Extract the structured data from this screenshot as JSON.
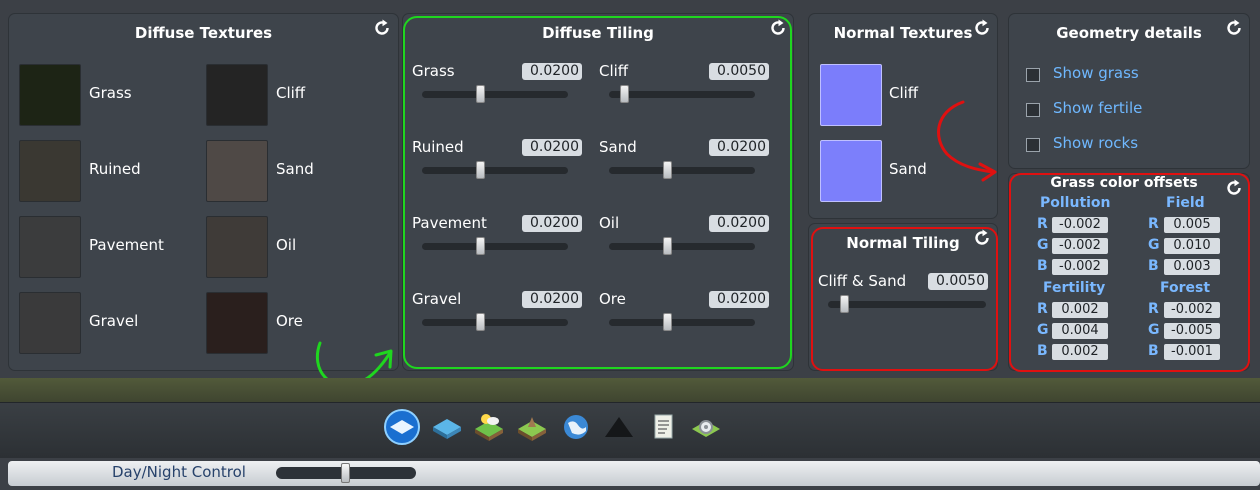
{
  "diffuse_textures": {
    "title": "Diffuse Textures",
    "items": [
      {
        "label": "Grass",
        "color": "#1d2415"
      },
      {
        "label": "Cliff",
        "color": "#242424"
      },
      {
        "label": "Ruined",
        "color": "#3a3832"
      },
      {
        "label": "Sand",
        "color": "#4f4946"
      },
      {
        "label": "Pavement",
        "color": "#3b3c3d"
      },
      {
        "label": "Oil",
        "color": "#3f3b38"
      },
      {
        "label": "Gravel",
        "color": "#3a3a3b"
      },
      {
        "label": "Ore",
        "color": "#2a1f1d"
      }
    ]
  },
  "diffuse_tiling": {
    "title": "Diffuse Tiling",
    "items": [
      {
        "label": "Grass",
        "value": "0.0200"
      },
      {
        "label": "Cliff",
        "value": "0.0050"
      },
      {
        "label": "Ruined",
        "value": "0.0200"
      },
      {
        "label": "Sand",
        "value": "0.0200"
      },
      {
        "label": "Pavement",
        "value": "0.0200"
      },
      {
        "label": "Oil",
        "value": "0.0200"
      },
      {
        "label": "Gravel",
        "value": "0.0200"
      },
      {
        "label": "Ore",
        "value": "0.0200"
      }
    ]
  },
  "normal_textures": {
    "title": "Normal Textures",
    "items": [
      {
        "label": "Cliff",
        "color": "#7b7dfb"
      },
      {
        "label": "Sand",
        "color": "#7c7ffb"
      }
    ]
  },
  "normal_tiling": {
    "title": "Normal Tiling",
    "items": [
      {
        "label": "Cliff & Sand",
        "value": "0.0050"
      }
    ]
  },
  "geometry_details": {
    "title": "Geometry details",
    "options": [
      {
        "label": "Show grass",
        "checked": false
      },
      {
        "label": "Show fertile",
        "checked": false
      },
      {
        "label": "Show rocks",
        "checked": false
      }
    ]
  },
  "grass_color_offsets": {
    "title": "Grass color offsets",
    "groups": [
      {
        "name": "Pollution",
        "channels": [
          {
            "ch": "R",
            "value": "-0.002"
          },
          {
            "ch": "G",
            "value": "-0.002"
          },
          {
            "ch": "B",
            "value": "-0.002"
          }
        ]
      },
      {
        "name": "Field",
        "channels": [
          {
            "ch": "R",
            "value": "0.005"
          },
          {
            "ch": "G",
            "value": "0.010"
          },
          {
            "ch": "B",
            "value": "0.003"
          }
        ]
      },
      {
        "name": "Fertility",
        "channels": [
          {
            "ch": "R",
            "value": "0.002"
          },
          {
            "ch": "G",
            "value": "0.004"
          },
          {
            "ch": "B",
            "value": "0.002"
          }
        ]
      },
      {
        "name": "Forest",
        "channels": [
          {
            "ch": "R",
            "value": "-0.002"
          },
          {
            "ch": "G",
            "value": "-0.005"
          },
          {
            "ch": "B",
            "value": "-0.001"
          }
        ]
      }
    ]
  },
  "toolbar": {
    "buttons": [
      "terrain-icon",
      "water-icon",
      "sun-weather-icon",
      "ground-icon",
      "globe-icon",
      "mountain-icon",
      "document-icon",
      "settings-icon"
    ]
  },
  "day_night": {
    "label": "Day/Night Control"
  },
  "colors": {
    "highlight_green": "#1fd61f",
    "highlight_red": "#e01010",
    "accent_blue": "#6fb8ff"
  }
}
